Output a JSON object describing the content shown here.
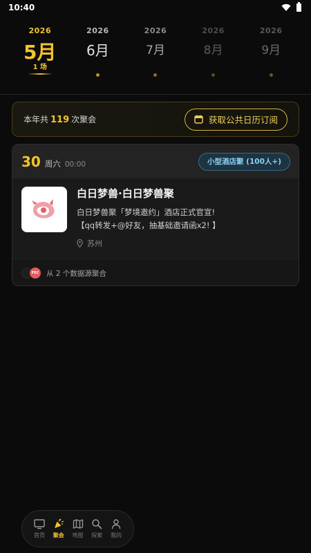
{
  "status_bar": {
    "time": "10:40"
  },
  "months": [
    {
      "year": "2026",
      "name": "5月",
      "count": "1 场"
    },
    {
      "year": "2026",
      "name": "6月"
    },
    {
      "year": "2026",
      "name": "7月"
    },
    {
      "year": "2026",
      "name": "8月"
    },
    {
      "year": "2026",
      "name": "9月"
    }
  ],
  "summary": {
    "prefix": "本年共",
    "count": "119",
    "suffix": "次聚会",
    "subscribe_label": "获取公共日历订阅"
  },
  "event": {
    "day": "30",
    "weekday": "周六",
    "time": "00:00",
    "tag": "小型酒店聚 (100人+)",
    "title": "白日梦兽·白日梦兽聚",
    "description": "白日梦兽聚「梦境邀约」酒店正式官宣!\n【qq转发+@好友，抽基础邀请函x2! 】",
    "location": "苏州",
    "source_badge": "FEC",
    "sources_text": "从 2 个数据源聚合"
  },
  "nav": {
    "items": [
      {
        "label": "首页",
        "icon": "tv-icon"
      },
      {
        "label": "聚会",
        "icon": "party-popper-icon"
      },
      {
        "label": "地图",
        "icon": "map-icon"
      },
      {
        "label": "探索",
        "icon": "search-icon"
      },
      {
        "label": "我的",
        "icon": "person-icon"
      }
    ],
    "active_index": 1
  },
  "colors": {
    "accent": "#f4c52a",
    "background": "#0b0b0b",
    "tag_text": "#8ad0f2"
  }
}
